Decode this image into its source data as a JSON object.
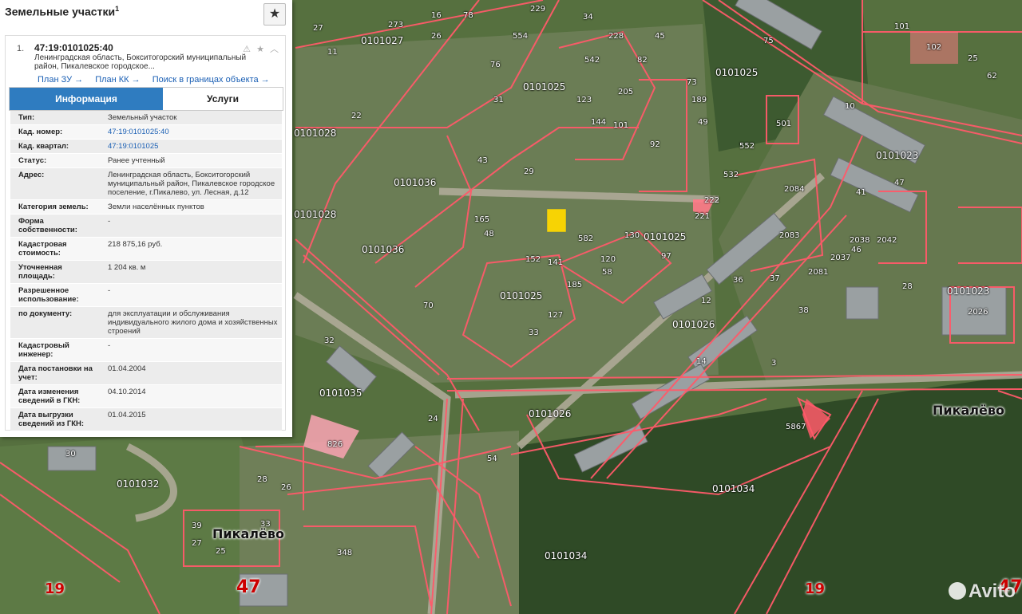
{
  "panel": {
    "title": "Земельные участки",
    "title_sup": "1",
    "star_icon": "★",
    "item_index": "1.",
    "cad_number": "47:19:0101025:40",
    "address_short": "Ленинградская область, Бокситогорский муниципальный район, Пикалевское городское...",
    "card_icons": "⚠ ★ ︿",
    "links": {
      "plan_zu": "План ЗУ →",
      "plan_kk": "План КК →",
      "search": "Поиск в границах объекта →"
    },
    "tabs": {
      "info": "Информация",
      "services": "Услуги"
    },
    "rows": [
      {
        "k": "Тип:",
        "v": "Земельный участок",
        "link": false
      },
      {
        "k": "Кад. номер:",
        "v": "47:19:0101025:40",
        "link": true
      },
      {
        "k": "Кад. квартал:",
        "v": "47:19:0101025",
        "link": true
      },
      {
        "k": "Статус:",
        "v": "Ранее учтенный",
        "link": false
      },
      {
        "k": "Адрес:",
        "v": "Ленинградская область, Бокситогорский муниципальный район, Пикалевское городское поселение, г.Пикалево, ул. Лесная, д.12",
        "link": false
      },
      {
        "k": "Категория земель:",
        "v": "Земли населённых пунктов",
        "link": false
      },
      {
        "k": "Форма собственности:",
        "v": "-",
        "link": false
      },
      {
        "k": "Кадастровая стоимость:",
        "v": "218 875,16 руб.",
        "link": false
      },
      {
        "k": "Уточненная площадь:",
        "v": "1 204 кв. м",
        "link": false
      },
      {
        "k": "Разрешенное использование:",
        "v": "-",
        "link": false
      },
      {
        "k": "по документу:",
        "v": "для эксплуатации и обслуживания индивидуального жилого дома и хозяйственных строений",
        "link": false
      },
      {
        "k": "Кадастровый инженер:",
        "v": "-",
        "link": false
      },
      {
        "k": "Дата постановки на учет:",
        "v": "01.04.2004",
        "link": false
      },
      {
        "k": "Дата изменения сведений в ГКН:",
        "v": "04.10.2014",
        "link": false
      },
      {
        "k": "Дата выгрузки сведений из ГКН:",
        "v": "01.04.2015",
        "link": false
      }
    ]
  },
  "map": {
    "quarters": [
      "0101027",
      "0101025",
      "0101025",
      "0101028",
      "0101028",
      "0101036",
      "0101036",
      "0101023",
      "0101025",
      "0101025",
      "0101026",
      "0101035",
      "0101026",
      "0101032",
      "0101034",
      "0101034",
      "0101023"
    ],
    "parcels": [
      "273",
      "78",
      "229",
      "228",
      "45",
      "102",
      "101",
      "75",
      "82",
      "542",
      "34",
      "554",
      "76",
      "26",
      "27",
      "73",
      "189",
      "205",
      "144",
      "123",
      "101",
      "92",
      "49",
      "501",
      "552",
      "532",
      "29",
      "43",
      "31",
      "10",
      "47",
      "41",
      "222",
      "221",
      "165",
      "48",
      "582",
      "130",
      "120",
      "97",
      "2083",
      "2081",
      "2084",
      "2038",
      "2037",
      "2042",
      "46",
      "37",
      "38",
      "36",
      "28",
      "2026",
      "12",
      "3",
      "14",
      "5867",
      "826",
      "24",
      "30",
      "32",
      "54",
      "28",
      "26",
      "33",
      "27",
      "25",
      "39",
      "348",
      "152",
      "141",
      "185",
      "127",
      "58",
      "33",
      "70",
      "16",
      "22",
      "11",
      "25",
      "62"
    ],
    "city_label": "Пикалёво",
    "city_label2": "Пикалёво",
    "road_47": "47",
    "road_19": "19",
    "watermark": "Avito"
  },
  "colors": {
    "accent": "#2f7cc0",
    "boundary": "#ff5a6a",
    "selected": "#ffd800"
  }
}
